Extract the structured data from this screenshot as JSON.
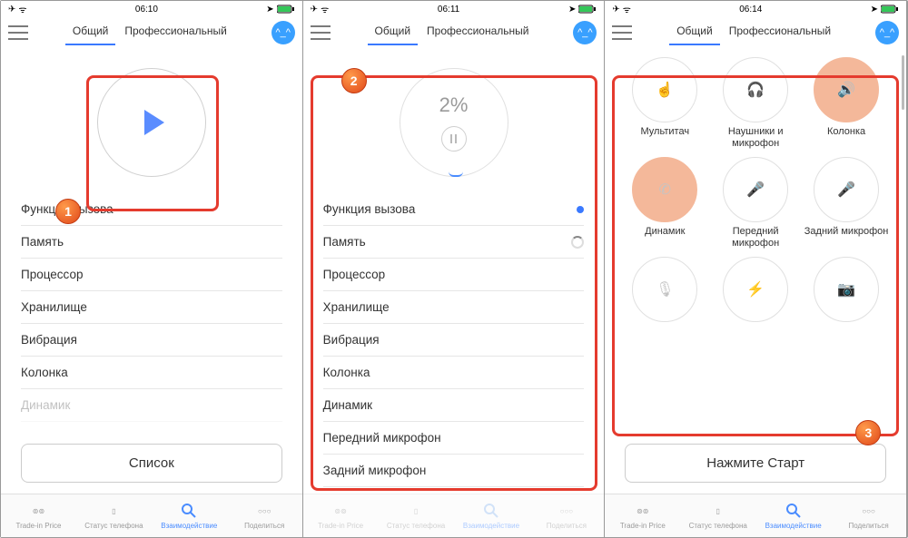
{
  "status": {
    "time1": "06:10",
    "time2": "06:11",
    "time3": "06:14"
  },
  "tabs": {
    "general": "Общий",
    "pro": "Профессиональный"
  },
  "progress": "2%",
  "items": [
    "Функция вызова",
    "Память",
    "Процессор",
    "Хранилище",
    "Вибрация",
    "Колонка",
    "Динамик",
    "Передний микрофон",
    "Задний микрофон"
  ],
  "btn_list": "Список",
  "btn_start": "Нажмите Старт",
  "nav": [
    "Trade-in Price",
    "Статус телефона",
    "Взаимодействие",
    "Поделиться"
  ],
  "grid": [
    "Мультитач",
    "Наушники и микрофон",
    "Колонка",
    "Динамик",
    "Передний микрофон",
    "Задний микрофон",
    "",
    "",
    ""
  ],
  "steps": {
    "1": "1",
    "2": "2",
    "3": "3"
  }
}
